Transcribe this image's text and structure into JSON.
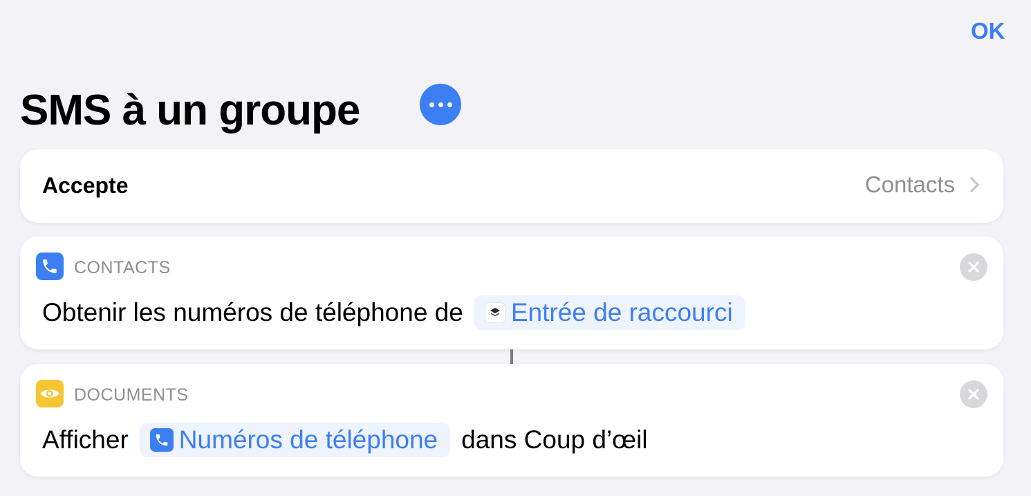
{
  "nav": {
    "done_label": "OK"
  },
  "shortcut": {
    "title": "SMS à un groupe"
  },
  "accept": {
    "label": "Accepte",
    "value": "Contacts"
  },
  "actions": [
    {
      "category": "CONTACTS",
      "icon": "phone-icon",
      "text_before": "Obtenir les numéros de téléphone de",
      "token": "Entrée de raccourci",
      "token_icon": "shortcut-input-icon",
      "text_after": ""
    },
    {
      "category": "DOCUMENTS",
      "icon": "eye-icon",
      "text_before": "Afficher",
      "token": "Numéros de téléphone",
      "token_icon": "phone-icon",
      "text_after": "dans Coup d’œil"
    }
  ],
  "colors": {
    "accent": "#3b7ff2",
    "background": "#f2f2f7",
    "documents_icon": "#f6c534",
    "secondary_text": "#8e8e93"
  }
}
